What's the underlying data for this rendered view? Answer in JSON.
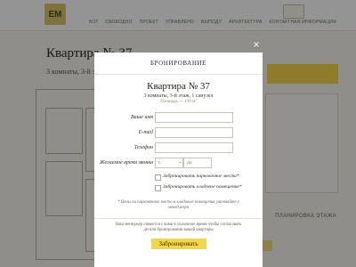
{
  "background": {
    "nav_items": [
      "БОГ",
      "СВОБОДНО",
      "ПРОЕКТ",
      "УПРАВЛЕНО",
      "ВЫПОДУ",
      "АРХИТЕКТУРА",
      "КОНТАКТНАЯ ИНФОРМАЦИЯ"
    ],
    "page_title": "Квартира № 37",
    "page_subtitle": "3 комнаты, 3-й эт",
    "side_label": "ПЛАНИРОВКА ЭТАЖА",
    "brand_colors": {
      "accent": "#f3d64a",
      "overlay": "rgba(0,0,0,0.42)"
    }
  },
  "modal": {
    "close_icon": "×",
    "header": "БРОНИРОВАНИЕ",
    "apartment_title": "Квартира № 37",
    "apartment_info": "3 комнаты, 3-й этаж, 1 санузел",
    "apartment_area": "Площадь — 130 м²",
    "fields": [
      {
        "label": "Ваше имя",
        "value": "",
        "placeholder": ""
      },
      {
        "label": "E-mail",
        "value": "",
        "placeholder": ""
      },
      {
        "label": "Телефон",
        "value": "",
        "placeholder": ""
      }
    ],
    "time": {
      "label": "Желаемое время звонка",
      "from_placeholder": "С",
      "dash": "–",
      "to_placeholder": "До"
    },
    "checkboxes": [
      {
        "label": "Забронировать парковочное место*",
        "checked": false
      },
      {
        "label": "Забронировать кладовое помещение*",
        "checked": false
      }
    ],
    "note": "* Цены на парковочное место и кладовые помещения уточняйте у менеджера",
    "info": "Наш менеджер свяжется с вами в указанное время чтобы согласовать детали бронирования вашей квартиры",
    "submit_label": "Забронировать"
  }
}
